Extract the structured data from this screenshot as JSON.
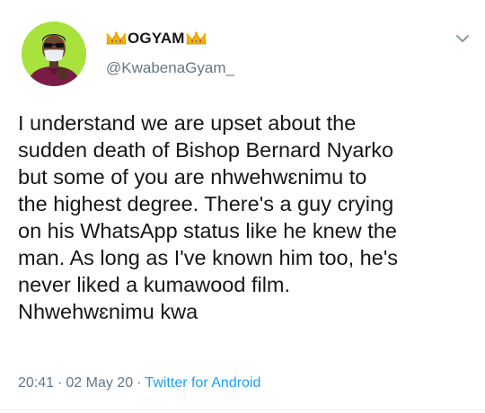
{
  "tweet": {
    "display_name": "OGYAM",
    "handle": "@KwabenaGyam_",
    "text": "I understand we are upset about the\nsudden death of Bishop Bernard Nyarko\nbut some of you are nhwehwɛnimu to\nthe highest degree. There's a guy crying\non his WhatsApp status like he knew the\nman. As long as I've known him too, he's\nnever liked a kumawood film.\nNhwehwɛnimu kwa",
    "time": "20:41",
    "date": "02 May 20",
    "separator": "·",
    "source": "Twitter for Android"
  },
  "icons": {
    "name_prefix": "crown-emoji",
    "name_suffix": "crown-emoji",
    "menu": "chevron-down-icon"
  },
  "colors": {
    "avatar_bg": "#a9e23d",
    "muted": "#657786",
    "link": "#1da1f2",
    "text": "#14171a"
  }
}
